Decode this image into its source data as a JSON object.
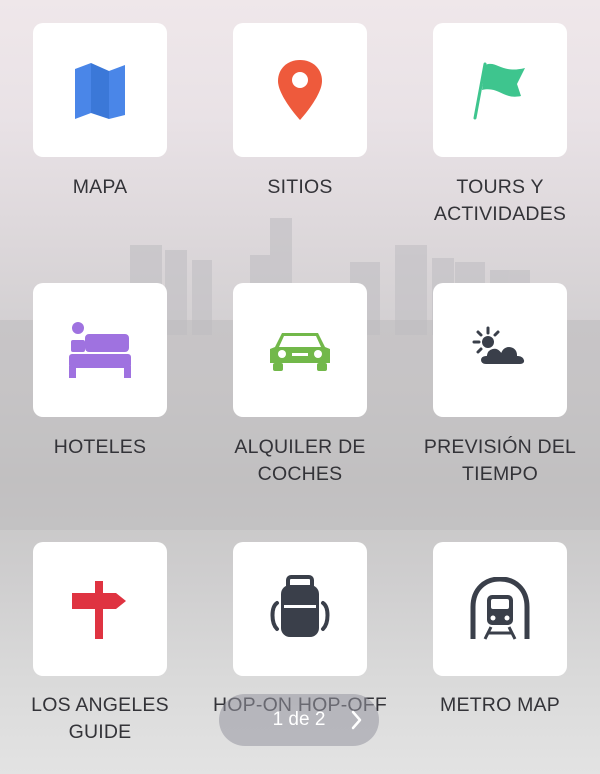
{
  "tiles": [
    {
      "label": "MAPA",
      "icon": "map-icon",
      "color": "#4a86e8"
    },
    {
      "label": "SITIOS",
      "icon": "location-pin-icon",
      "color": "#ee5a3c"
    },
    {
      "label": "TOURS Y\nACTIVIDADES",
      "icon": "flag-icon",
      "color": "#3ec58e"
    },
    {
      "label": "HOTELES",
      "icon": "bed-icon",
      "color": "#9f72e0"
    },
    {
      "label": "ALQUILER DE\nCOCHES",
      "icon": "car-icon",
      "color": "#72b84a"
    },
    {
      "label": "PREVISIÓN DEL\nTIEMPO",
      "icon": "weather-icon",
      "color": "#3a3f4a"
    },
    {
      "label": "LOS ANGELES\nGUIDE",
      "icon": "signpost-icon",
      "color": "#df3341"
    },
    {
      "label": "HOP-ON HOP-OFF",
      "icon": "backpack-icon",
      "color": "#3a3f4a"
    },
    {
      "label": "METRO MAP",
      "icon": "metro-icon",
      "color": "#3a3f4a"
    }
  ],
  "pager": {
    "text": "1 de 2",
    "icon": "chevron-right-icon"
  }
}
